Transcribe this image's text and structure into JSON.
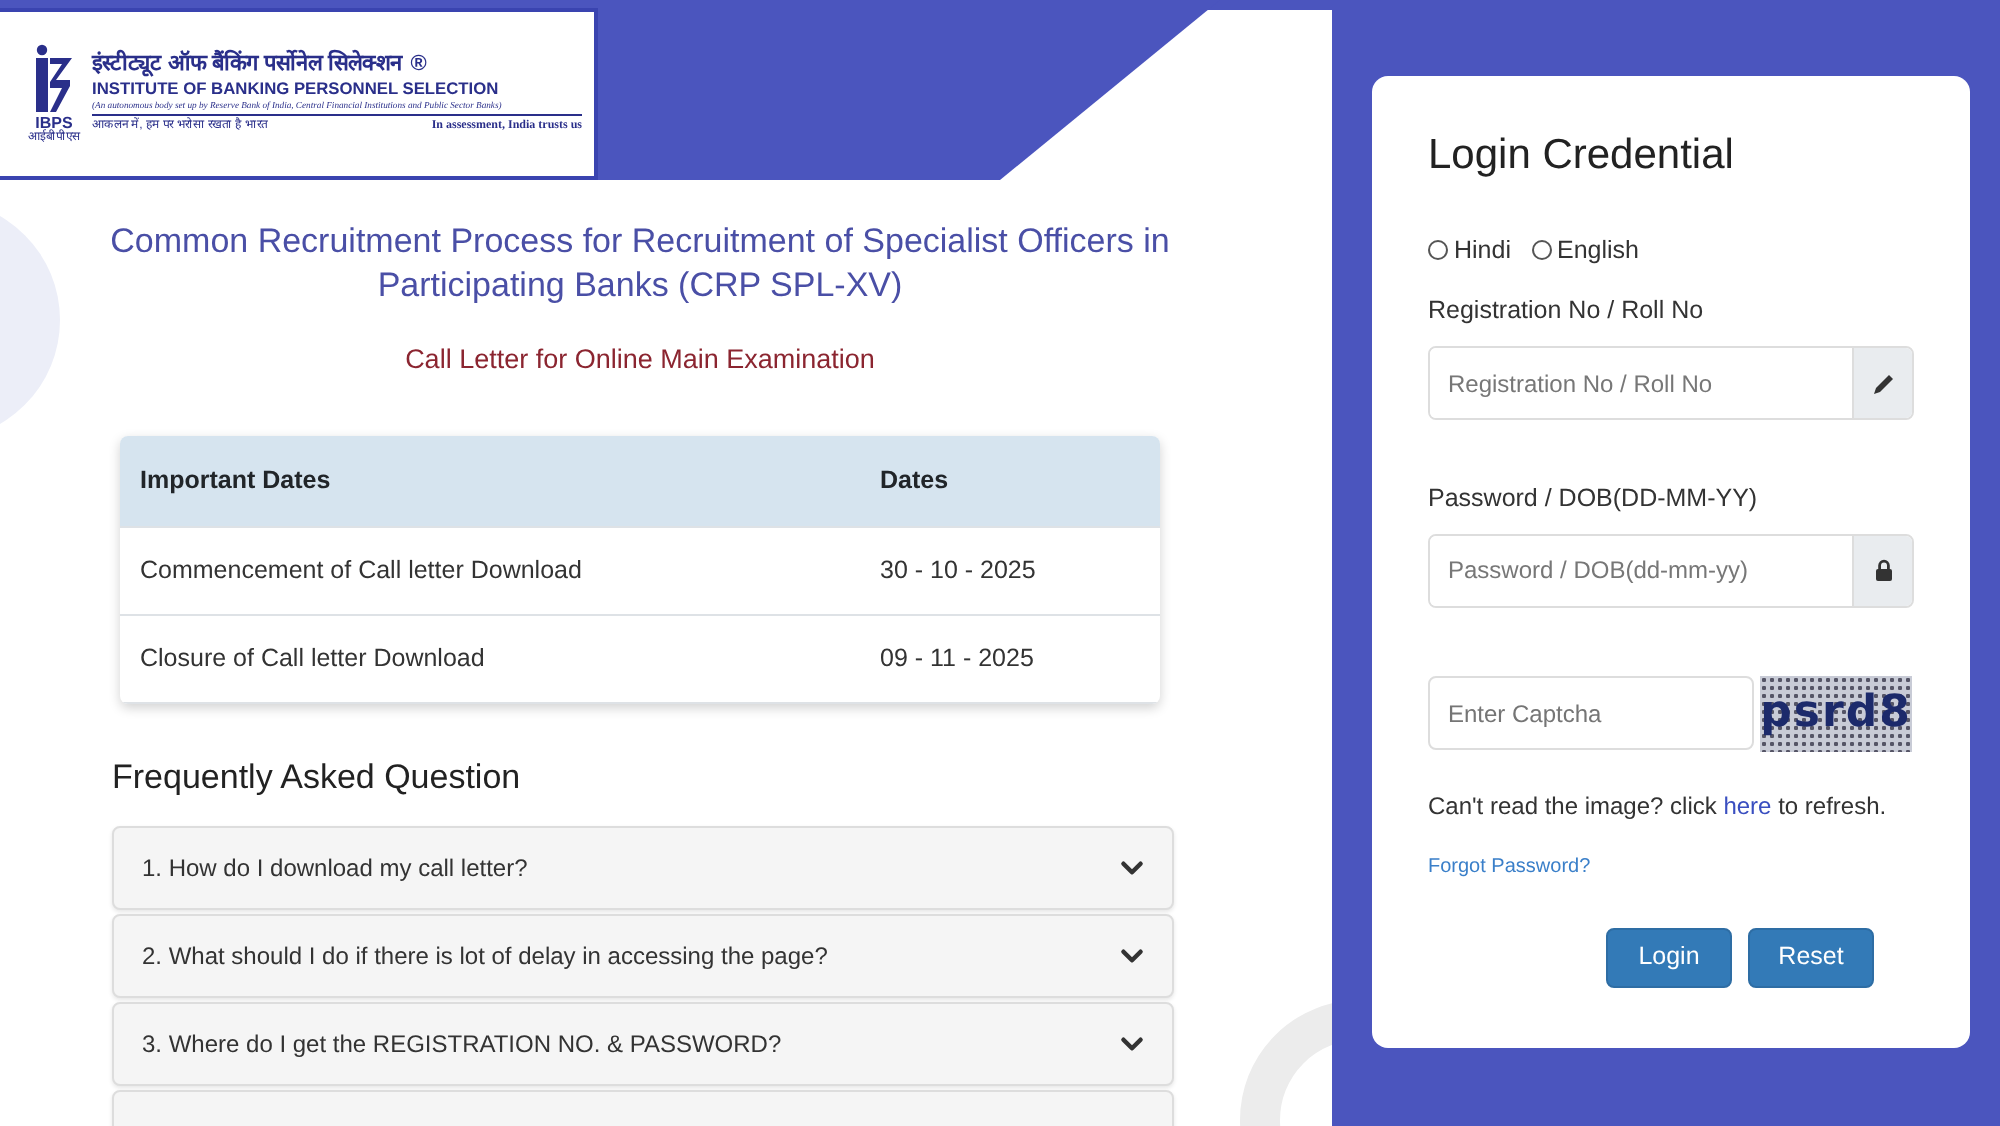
{
  "logo": {
    "hindi_name": "इंस्टीट्यूट ऑफ बैंकिंग पर्सोनेल सिलेक्शन",
    "registered_mark": "®",
    "english_name": "INSTITUTE OF BANKING PERSONNEL SELECTION",
    "description": "(An autonomous body set up by Reserve Bank of India, Central Financial Institutions and Public Sector Banks)",
    "abbreviation": "IBPS",
    "abbreviation_hindi": "आईबीपीएस",
    "tagline_hindi": "आकलन में, हम पर भरोसा रखता है भारत",
    "tagline_english": "In assessment, India trusts us"
  },
  "title": "Common Recruitment Process for Recruitment of Specialist Officers in Participating Banks (CRP SPL-XV)",
  "subtitle": "Call Letter for Online Main Examination",
  "table": {
    "columns": [
      "Important Dates",
      "Dates"
    ],
    "rows": [
      [
        "Commencement of Call letter Download",
        "30 - 10 - 2025"
      ],
      [
        "Closure of Call letter Download",
        "09 - 11 - 2025"
      ]
    ]
  },
  "faq": {
    "heading": "Frequently Asked Question",
    "items": [
      {
        "question": "1. How do I download my call letter?",
        "expanded": false
      },
      {
        "question": "2. What should I do if there is lot of delay in accessing the page?",
        "expanded": false
      },
      {
        "question": "3. Where do I get the REGISTRATION NO. & PASSWORD?",
        "expanded": false
      }
    ]
  },
  "login": {
    "title": "Login Credential",
    "languages": [
      {
        "label": "Hindi",
        "selected": false
      },
      {
        "label": "English",
        "selected": false
      }
    ],
    "registration": {
      "label": "Registration No / Roll No",
      "placeholder": "Registration No / Roll No"
    },
    "password": {
      "label": "Password / DOB(DD-MM-YY)",
      "placeholder": "Password / DOB(dd-mm-yy)"
    },
    "captcha": {
      "placeholder": "Enter Captcha",
      "image_text": "psrd8"
    },
    "refresh_text": {
      "before": "Can't read the image? click ",
      "link": "here",
      "after": " to refresh."
    },
    "forgot_link": "Forgot Password?",
    "buttons": [
      "Login",
      "Reset"
    ]
  }
}
